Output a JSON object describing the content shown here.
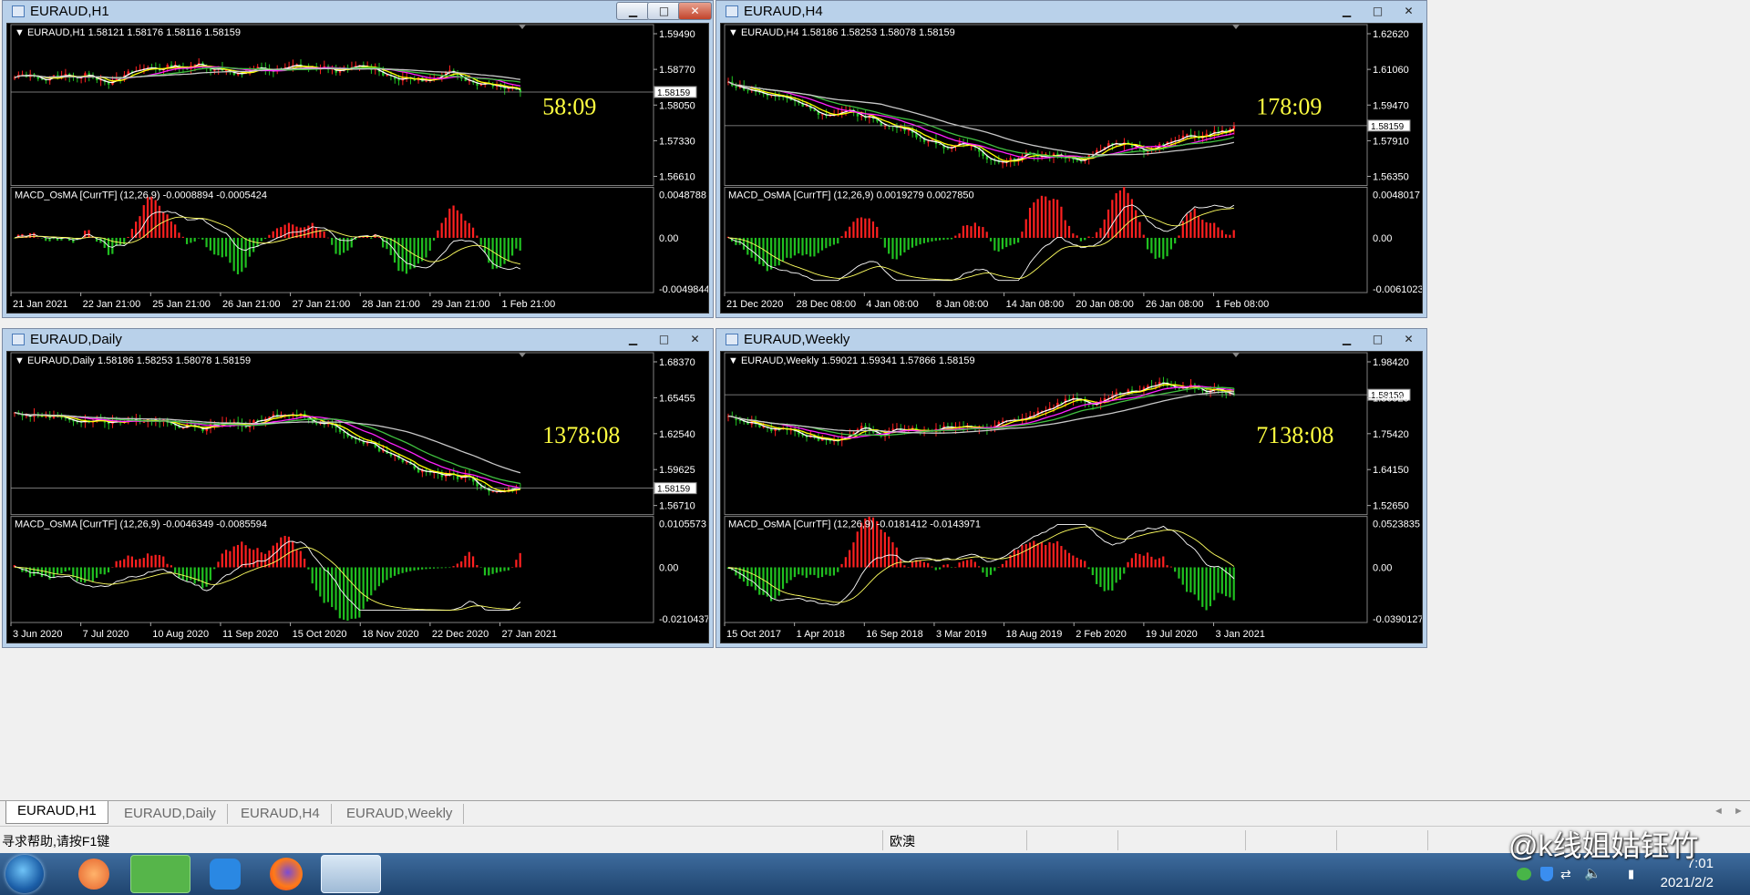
{
  "windows": [
    {
      "title": "EURAUD,H1",
      "info": "EURAUD,H1  1.58121 1.58176 1.58116 1.58159",
      "price_ticks": [
        "1.59490",
        "1.58770",
        "1.58050",
        "1.57330",
        "1.56610"
      ],
      "current_price": "1.58159",
      "countdown": "58:09",
      "macd_label": "MACD_OsMA [CurrTF] (12,26,9) -0.0008894 -0.0005424",
      "macd_ticks": [
        "0.0048788",
        "0.00",
        "-0.0049844"
      ],
      "time_labels": [
        "21 Jan 2021",
        "22 Jan 21:00",
        "25 Jan 21:00",
        "26 Jan 21:00",
        "27 Jan 21:00",
        "28 Jan 21:00",
        "29 Jan 21:00",
        "1 Feb 21:00"
      ],
      "show_minmax": true
    },
    {
      "title": "EURAUD,H4",
      "info": "EURAUD,H4  1.58186 1.58253 1.58078 1.58159",
      "price_ticks": [
        "1.62620",
        "1.61060",
        "1.59470",
        "1.57910",
        "1.56350"
      ],
      "current_price": "1.58159",
      "countdown": "178:09",
      "macd_label": "MACD_OsMA [CurrTF] (12,26,9) 0.0019279 0.0027850",
      "macd_ticks": [
        "0.0048017",
        "0.00",
        "-0.0061023"
      ],
      "time_labels": [
        "21 Dec 2020",
        "28 Dec 08:00",
        "4 Jan 08:00",
        "8 Jan 08:00",
        "14 Jan 08:00",
        "20 Jan 08:00",
        "26 Jan 08:00",
        "1 Feb 08:00"
      ],
      "show_minmax": false
    },
    {
      "title": "EURAUD,Daily",
      "info": "EURAUD,Daily  1.58186 1.58253 1.58078 1.58159",
      "price_ticks": [
        "1.68370",
        "1.65455",
        "1.62540",
        "1.59625",
        "1.56710"
      ],
      "current_price": "1.58159",
      "countdown": "1378:08",
      "macd_label": "MACD_OsMA [CurrTF] (12,26,9) -0.0046349 -0.0085594",
      "macd_ticks": [
        "0.0105573",
        "0.00",
        "-0.0210437"
      ],
      "time_labels": [
        "3 Jun 2020",
        "7 Jul 2020",
        "10 Aug 2020",
        "11 Sep 2020",
        "15 Oct 2020",
        "18 Nov 2020",
        "22 Dec 2020",
        "27 Jan 2021"
      ],
      "show_minmax": true
    },
    {
      "title": "EURAUD,Weekly",
      "info": "EURAUD,Weekly  1.59021 1.59341 1.57866 1.58159",
      "price_ticks": [
        "1.98420",
        "1.86920",
        "1.75420",
        "1.64150",
        "1.52650"
      ],
      "current_price": "1.58159",
      "countdown": "7138:08",
      "macd_label": "MACD_OsMA [CurrTF] (12,26,9) -0.0181412 -0.0143971",
      "macd_ticks": [
        "0.0523835",
        "0.00",
        "-0.0390127"
      ],
      "time_labels": [
        "15 Oct 2017",
        "1 Apr 2018",
        "16 Sep 2018",
        "3 Mar 2019",
        "18 Aug 2019",
        "2 Feb 2020",
        "19 Jul 2020",
        "3 Jan 2021"
      ],
      "show_minmax": true
    }
  ],
  "tabs": [
    "EURAUD,H1",
    "EURAUD,Daily",
    "EURAUD,H4",
    "EURAUD,Weekly"
  ],
  "status": {
    "help_text": "寻求帮助,请按F1键",
    "symbol_name": "欧澳"
  },
  "taskbar": {
    "time": "7:01",
    "date": "2021/2/2"
  },
  "watermark": "@k线姐姑钰竹",
  "icons": [
    "window-restore-icon",
    "minimize-icon",
    "maximize-icon",
    "close-icon",
    "windows-start-icon",
    "wechat-icon",
    "firefox-icon",
    "network-icon",
    "volume-muted-icon"
  ],
  "colors": {
    "bull": "#ff2020",
    "bear": "#20c020",
    "countdown": "#ffff40",
    "ma_white": "#ffffff",
    "ma_yellow": "#ffff00",
    "ma_magenta": "#ff20ff",
    "ma_green": "#40c040",
    "ma_gray": "#c8c8c8"
  }
}
